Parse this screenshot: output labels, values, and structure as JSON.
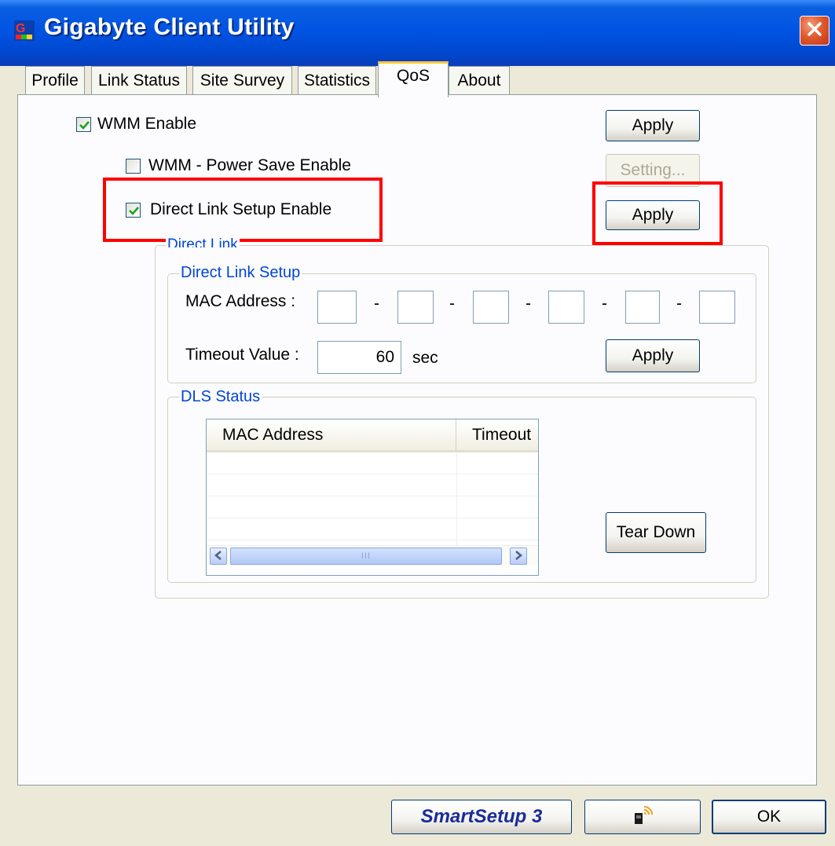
{
  "window": {
    "title": "Gigabyte Client Utility"
  },
  "tabs": [
    {
      "label": "Profile"
    },
    {
      "label": "Link Status"
    },
    {
      "label": "Site Survey"
    },
    {
      "label": "Statistics"
    },
    {
      "label": "QoS",
      "active": true
    },
    {
      "label": "About"
    }
  ],
  "qos": {
    "wmm_enable": {
      "label": "WMM Enable",
      "checked": true
    },
    "wmm_power_save": {
      "label": "WMM - Power Save Enable",
      "checked": false
    },
    "direct_link_enable": {
      "label": "Direct Link Setup Enable",
      "checked": true
    },
    "apply_wmm_label": "Apply",
    "setting_label": "Setting...",
    "apply_dls_label": "Apply"
  },
  "direct_link": {
    "group_label": "Direct Link",
    "setup": {
      "group_label": "Direct Link Setup",
      "mac_label": "MAC Address :",
      "separator": "-",
      "mac_octets": [
        "",
        "",
        "",
        "",
        "",
        ""
      ],
      "timeout_label": "Timeout Value :",
      "timeout_value": "60",
      "timeout_unit": "sec",
      "apply_label": "Apply"
    },
    "status": {
      "group_label": "DLS Status",
      "columns": [
        "MAC Address",
        "Timeout"
      ],
      "rows": [],
      "scroll_grip": "III",
      "tear_down_label": "Tear Down"
    }
  },
  "footer": {
    "smartsetup_label": "SmartSetup 3",
    "ok_label": "OK"
  },
  "icons": {
    "app": "gigabyte-logo-icon",
    "close": "close-icon",
    "check": "checkmark-icon",
    "wireless": "wireless-signal-icon",
    "scroll_left": "arrow-left-icon",
    "scroll_right": "arrow-right-icon"
  },
  "colors": {
    "titlebar": "#0054e3",
    "highlight": "#ff0000",
    "group_label": "#0046d5",
    "tab_active_accent": "#ffc83c"
  }
}
